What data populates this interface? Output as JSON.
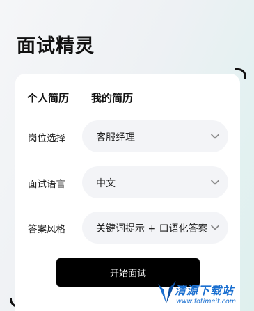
{
  "app": {
    "title": "面试精灵"
  },
  "tabs": [
    {
      "label": "个人简历"
    },
    {
      "label": "我的简历"
    }
  ],
  "form": {
    "position": {
      "label": "岗位选择",
      "value": "客服经理"
    },
    "language": {
      "label": "面试语言",
      "value": "中文"
    },
    "answer_style": {
      "label": "答案风格",
      "value": "关键词提示 + 口语化答案"
    }
  },
  "actions": {
    "start_label": "开始面试"
  },
  "watermark": {
    "title": "清源下载站",
    "url": "www.fotimeit.com"
  },
  "colors": {
    "accent": "#000000",
    "select_bg": "#f3f4f7",
    "watermark": "#1a6fd0"
  },
  "icons": {
    "dropdown": "chevron-down-icon"
  }
}
